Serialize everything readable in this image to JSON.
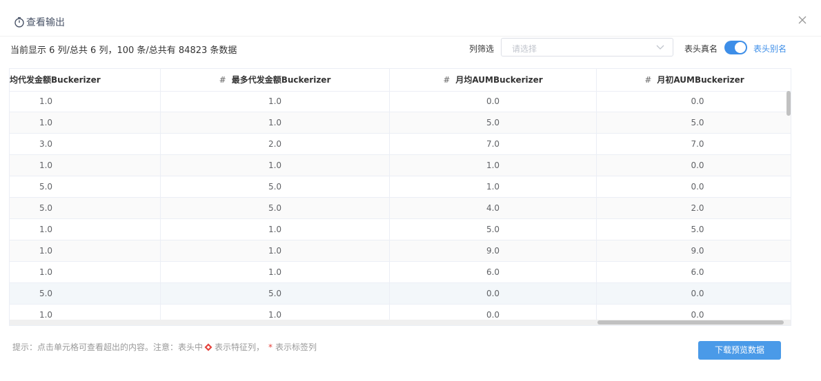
{
  "dialog": {
    "title": "查看输出",
    "summary": "当前显示 6 列/总共 6 列，100 条/总共有 84823 条数据"
  },
  "filter": {
    "label": "列筛选",
    "placeholder": "请选择"
  },
  "header_toggle": {
    "real_label": "表头真名",
    "alias_label": "表头别名",
    "on": true
  },
  "table": {
    "hash": "#",
    "columns": [
      "均代发金额Buckerizer",
      "最多代发金额Buckerizer",
      "月均AUMBuckerizer",
      "月初AUMBuckerizer"
    ],
    "rows": [
      [
        "1.0",
        "1.0",
        "0.0",
        "0.0"
      ],
      [
        "1.0",
        "1.0",
        "5.0",
        "5.0"
      ],
      [
        "3.0",
        "2.0",
        "7.0",
        "7.0"
      ],
      [
        "1.0",
        "1.0",
        "1.0",
        "0.0"
      ],
      [
        "5.0",
        "5.0",
        "1.0",
        "0.0"
      ],
      [
        "5.0",
        "5.0",
        "4.0",
        "2.0"
      ],
      [
        "1.0",
        "1.0",
        "5.0",
        "5.0"
      ],
      [
        "1.0",
        "1.0",
        "9.0",
        "9.0"
      ],
      [
        "1.0",
        "1.0",
        "6.0",
        "6.0"
      ],
      [
        "5.0",
        "5.0",
        "0.0",
        "0.0"
      ],
      [
        "1.0",
        "1.0",
        "0.0",
        "0.0"
      ]
    ]
  },
  "footer": {
    "hint_prefix": "提示：点击单元格可查看超出的内容。注意：表头中",
    "hint_feature": "表示特征列，",
    "hint_star": "*",
    "hint_label": "表示标签列",
    "download_label": "下载预览数据"
  },
  "colors": {
    "accent": "#3d8ee8",
    "button": "#4a9ae8",
    "star": "#e5403a"
  }
}
